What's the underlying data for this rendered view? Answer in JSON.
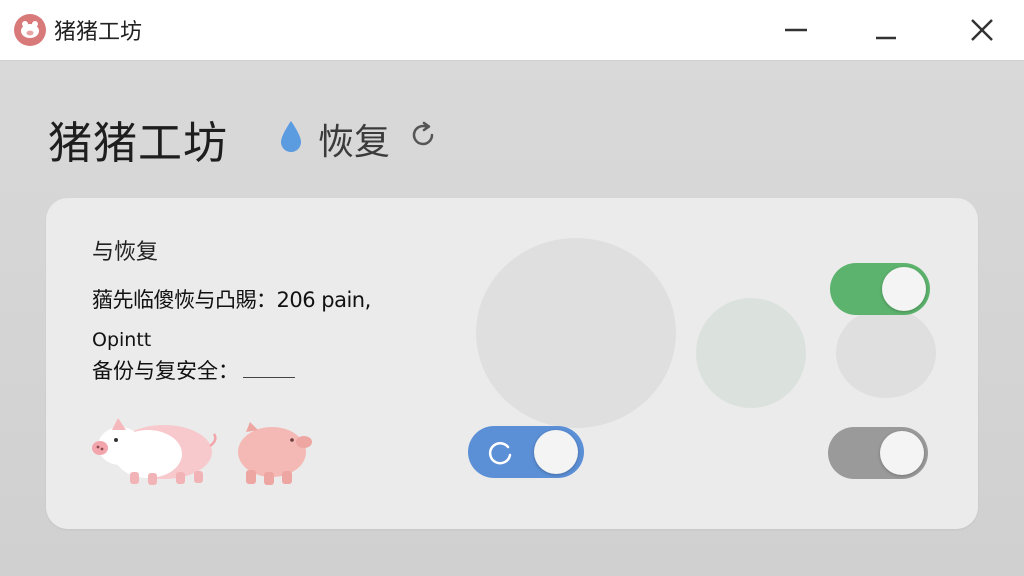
{
  "window": {
    "title": "猪猪工坊"
  },
  "header": {
    "title": "猪猪工坊",
    "status_label": "恢复"
  },
  "card": {
    "section_title": "与恢复",
    "row1_text": "蕕先临傻恢与凸賜：206 pain,",
    "row2_small_label": "Opintt",
    "row2_label": "备份与复安全："
  },
  "toggles": {
    "top_right": {
      "state": "on",
      "color": "#5cb36d"
    },
    "middle": {
      "state": "loading",
      "color": "#5b8fd6"
    },
    "bottom_right": {
      "state": "on",
      "color": "#9a9a9a"
    }
  },
  "icons": [
    "app-pig-icon",
    "minimize-icon",
    "minimize-icon",
    "close-icon",
    "water-drop-icon",
    "refresh-icon",
    "loading-spinner-icon",
    "pig-icon",
    "pig-icon"
  ]
}
